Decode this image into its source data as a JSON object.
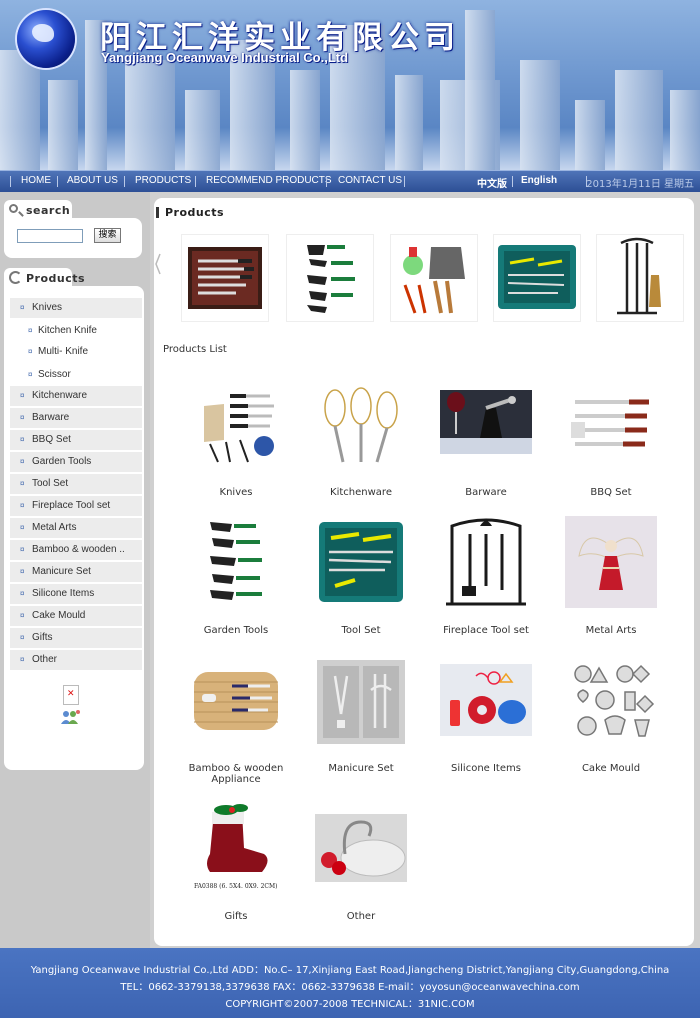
{
  "header": {
    "company_cn": "阳江汇洋实业有限公司",
    "company_en": "Yangjiang Oceanwave Industrial Co.,Ltd"
  },
  "nav": {
    "items": [
      "HOME",
      "ABOUT US",
      "PRODUCTS",
      "RECOMMEND PRODUCTS",
      "CONTACT US"
    ],
    "lang_cn": "中文版",
    "lang_en": "English",
    "date": "2013年1月11日 星期五"
  },
  "sidebar": {
    "search_title": "search",
    "search_placeholder": "",
    "search_button": "搜索",
    "products_title": "Products",
    "categories": [
      {
        "label": "Knives",
        "sub": false
      },
      {
        "label": "Kitchen Knife",
        "sub": true
      },
      {
        "label": "Multi- Knife",
        "sub": true
      },
      {
        "label": "Scissor",
        "sub": true
      },
      {
        "label": "Kitchenware",
        "sub": false
      },
      {
        "label": "Barware",
        "sub": false
      },
      {
        "label": "BBQ Set",
        "sub": false
      },
      {
        "label": "Garden Tools",
        "sub": false
      },
      {
        "label": "Tool Set",
        "sub": false
      },
      {
        "label": "Fireplace Tool set",
        "sub": false
      },
      {
        "label": "Metal Arts",
        "sub": false
      },
      {
        "label": "Bamboo & wooden ..",
        "sub": false
      },
      {
        "label": "Manicure Set",
        "sub": false
      },
      {
        "label": "Silicone Items",
        "sub": false
      },
      {
        "label": "Cake Mould",
        "sub": false
      },
      {
        "label": "Gifts",
        "sub": false
      },
      {
        "label": "Other",
        "sub": false
      }
    ]
  },
  "main": {
    "section_title": "Products",
    "list_title": "Products List",
    "products": [
      {
        "name": "Knives"
      },
      {
        "name": "Kitchenware"
      },
      {
        "name": "Barware"
      },
      {
        "name": "BBQ Set"
      },
      {
        "name": "Garden Tools"
      },
      {
        "name": "Tool Set"
      },
      {
        "name": "Fireplace Tool set"
      },
      {
        "name": "Metal Arts"
      },
      {
        "name": "Bamboo & wooden Appliance"
      },
      {
        "name": "Manicure Set"
      },
      {
        "name": "Silicone Items"
      },
      {
        "name": "Cake Mould"
      },
      {
        "name": "Gifts"
      },
      {
        "name": "Other"
      }
    ],
    "gift_caption": "FA0388 (6. 5X4. 0X9. 2CM)"
  },
  "footer": {
    "line1": "Yangjiang Oceanwave Industrial Co.,Ltd   ADD：No.C– 17,Xinjiang East Road,Jiangcheng District,Yangjiang City,Guangdong,China",
    "line2": "TEL：0662-3379138,3379638   FAX：0662-3379638   E-mail：yoyosun@oceanwavechina.com",
    "line3": "COPYRIGHT©2007-2008    TECHNICAL：31NIC.COM"
  },
  "colors": {
    "nav": "#3a5da3",
    "footer": "#4a74c2",
    "sidebar_bg": "#c9c9c9",
    "bullet": "#4a6fb0"
  }
}
